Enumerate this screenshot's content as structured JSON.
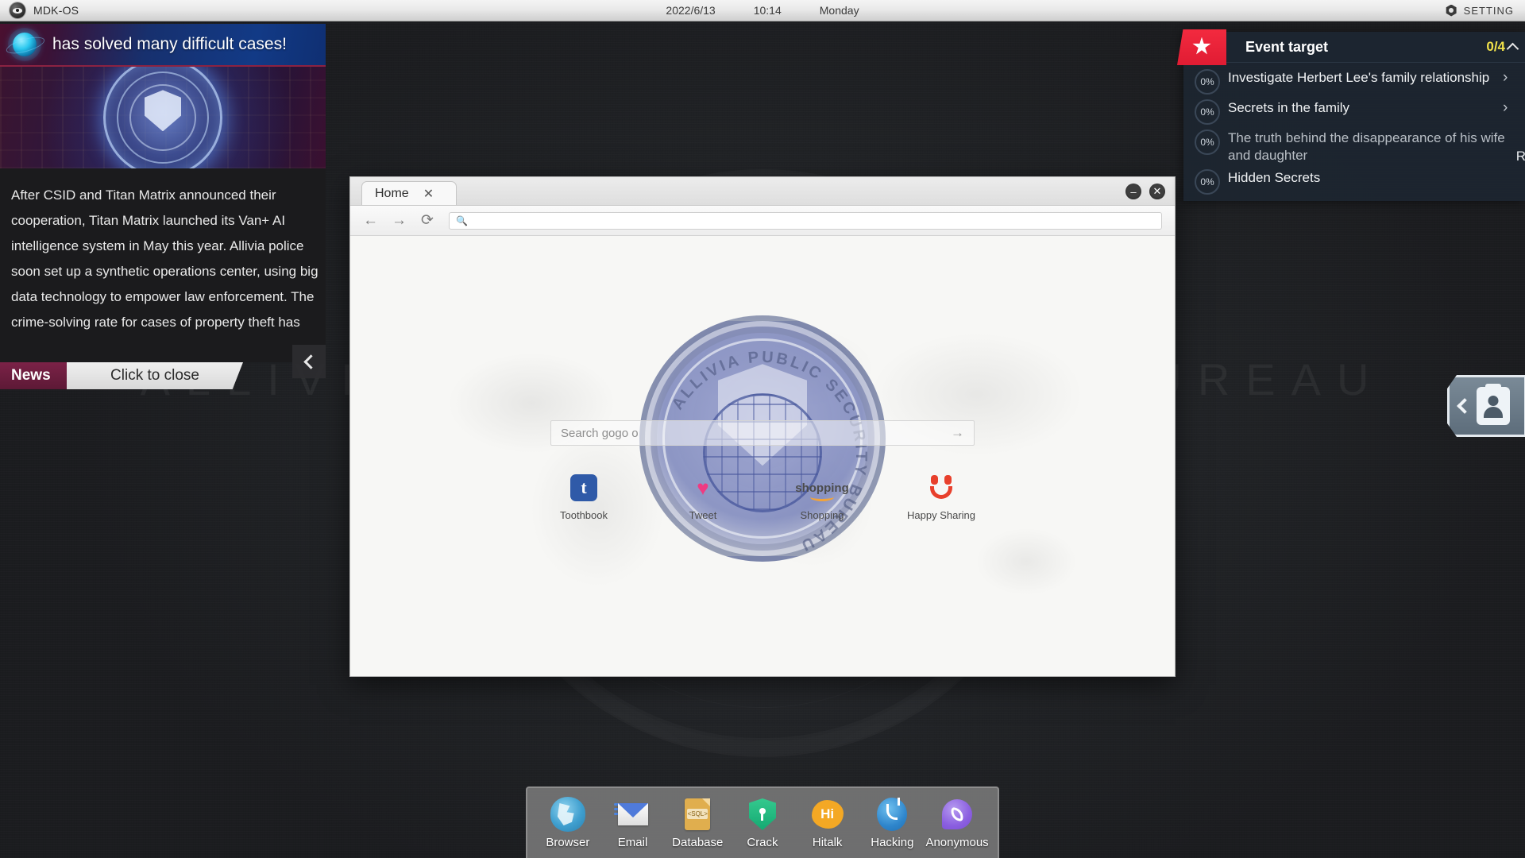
{
  "topbar": {
    "os_logo_icon": "eye-logo-icon",
    "os_name": "MDK-OS",
    "date": "2022/6/13",
    "time": "10:14",
    "weekday": "Monday",
    "setting_icon": "gear-icon",
    "setting_label": "SETTING"
  },
  "desktop": {
    "watermark": "ALLIVIA PUBLIC SECURITY BUREAU"
  },
  "news": {
    "globe_icon": "globe-icon",
    "headline": "has solved many difficult cases!",
    "banner_seal_icon": "police-seal-icon",
    "body_lines": [
      "After CSID and Titan Matrix announced their",
      "cooperation, Titan Matrix launched its Van+ AI",
      "intelligence system in May this year. Allivia police",
      "soon set up a synthetic operations center, using big",
      "data technology to empower law enforcement. The",
      "crime-solving rate for cases of property theft has"
    ],
    "collapse_icon": "chevron-left-icon",
    "tag_label": "News",
    "close_label": "Click to close"
  },
  "event_panel": {
    "star_icon": "star-icon",
    "title": "Event target",
    "count": "0/4",
    "collapse_icon": "chevron-up-icon",
    "side_label": "Reasoning",
    "items": [
      {
        "percent": "0%",
        "label": "Investigate Herbert Lee's family relationship",
        "arrow_icon": "chevron-right-icon",
        "has_arrow": true
      },
      {
        "percent": "0%",
        "label": "Secrets in the family",
        "arrow_icon": "chevron-right-icon",
        "has_arrow": true
      },
      {
        "percent": "0%",
        "label": "The truth behind the disappearance of his wife and daughter",
        "arrow_icon": "",
        "has_arrow": false
      },
      {
        "percent": "0%",
        "label": "Hidden Secrets",
        "arrow_icon": "",
        "has_arrow": false
      }
    ]
  },
  "profile_tab": {
    "chevron_icon": "chevron-left-icon",
    "badge_icon": "id-badge-icon"
  },
  "browser": {
    "tab_title": "Home",
    "tab_close_icon": "close-icon",
    "minimize_icon": "minimize-icon",
    "minimize_glyph": "–",
    "close_icon": "window-close-icon",
    "close_glyph": "✕",
    "back_icon": "arrow-left-icon",
    "back_glyph": "←",
    "forward_icon": "arrow-right-icon",
    "forward_glyph": "→",
    "reload_icon": "reload-icon",
    "reload_glyph": "⟳",
    "url_search_icon": "search-icon",
    "url_value": "",
    "url_placeholder": "",
    "emblem_text": "ALLIVIA PUBLIC SECURITY BUREAU",
    "search_placeholder": "Search gogo o",
    "search_submit_icon": "arrow-right-icon",
    "search_submit_glyph": "→",
    "shortcuts": [
      {
        "label": "Toothbook",
        "icon": "toothbook-icon",
        "glyph": "t"
      },
      {
        "label": "Tweet",
        "icon": "tweet-icon",
        "glyph": "ʮ"
      },
      {
        "label": "Shopping",
        "icon": "shopping-icon",
        "glyph": "shopping"
      },
      {
        "label": "Happy Sharing",
        "icon": "happy-sharing-icon",
        "glyph": ""
      }
    ]
  },
  "dock": {
    "items": [
      {
        "label": "Browser",
        "icon": "browser-globe-icon"
      },
      {
        "label": "Email",
        "icon": "email-envelope-icon"
      },
      {
        "label": "Database",
        "icon": "database-sql-file-icon",
        "tag": "<SQL>"
      },
      {
        "label": "Crack",
        "icon": "crack-shield-key-icon"
      },
      {
        "label": "Hitalk",
        "icon": "hitalk-icon",
        "glyph": "Hi"
      },
      {
        "label": "Hacking",
        "icon": "hacking-hook-icon"
      },
      {
        "label": "Anonymous",
        "icon": "anonymous-phone-icon"
      }
    ]
  },
  "colors": {
    "accent_red": "#e01c33",
    "accent_yellow": "#f2e24a",
    "panel_dark": "#1d2530",
    "news_tag": "#7b2247"
  }
}
